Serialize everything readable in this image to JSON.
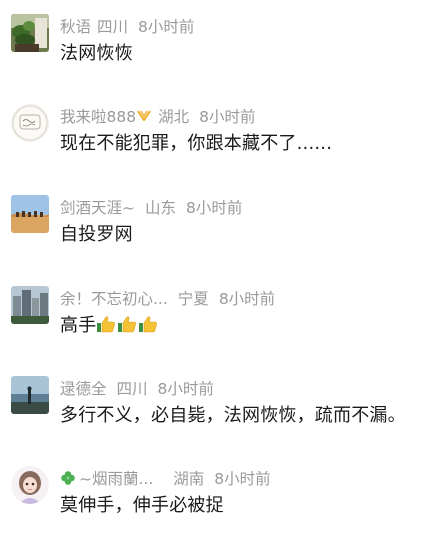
{
  "comments": [
    {
      "username": "秋语",
      "location": "四川",
      "time": "8小时前",
      "text": "法网恢恢",
      "avatar_icon": "plant-photo-avatar"
    },
    {
      "username": "我来啦888",
      "badge_icon": "vip-badge-icon",
      "location": "湖北",
      "time": "8小时前",
      "text": "现在不能犯罪，你跟本藏不了......",
      "avatar_icon": "handwriting-avatar"
    },
    {
      "username": "剑酒天涯~",
      "location": "山东",
      "time": "8小时前",
      "text": "自投罗网",
      "avatar_icon": "desert-camels-avatar"
    },
    {
      "username": "余！不忘初心...",
      "location": "宁夏",
      "time": "8小时前",
      "text": "高手",
      "emoji": [
        "thumbs-up",
        "thumbs-up",
        "thumbs-up"
      ],
      "avatar_icon": "city-buildings-avatar"
    },
    {
      "username": "逯德全",
      "location": "四川",
      "time": "8小时前",
      "text": "多行不义，必自毙，法网恢恢，疏而不漏。",
      "avatar_icon": "seaside-person-avatar"
    },
    {
      "username": "~烟雨蘭...",
      "name_prefix_icon": "clover-icon",
      "location": "湖南",
      "time": "8小时前",
      "text": "莫伸手，伸手必被捉",
      "avatar_icon": "girl-doll-avatar"
    }
  ],
  "colors": {
    "meta": "#9a9a9a",
    "text": "#1a1a1a",
    "vip_badge": "#f2b133",
    "clover": "#4caf50",
    "thumb": "#f5c236"
  }
}
